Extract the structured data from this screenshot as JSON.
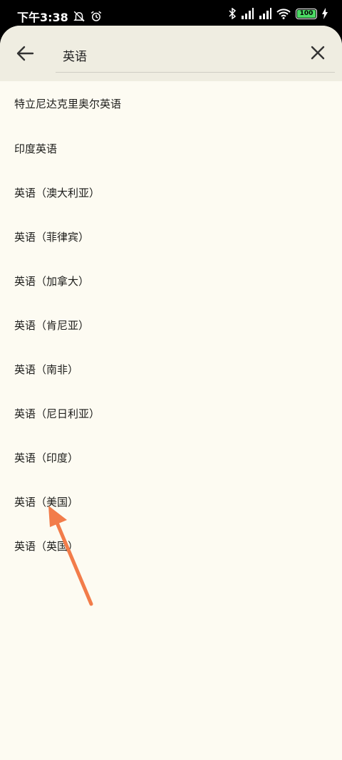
{
  "status_bar": {
    "time": "下午3:38",
    "battery": "100"
  },
  "search": {
    "value": "英语"
  },
  "results": [
    "特立尼达克里奥尔英语",
    "印度英语",
    "英语（澳大利亚）",
    "英语（菲律宾）",
    "英语（加拿大）",
    "英语（肯尼亚）",
    "英语（南非）",
    "英语（尼日利亚）",
    "英语（印度）",
    "英语（美国）",
    "英语（英国）"
  ],
  "icons": [
    "bell-off-icon",
    "alarm-icon",
    "bluetooth-icon",
    "signal-icon",
    "wifi-icon",
    "battery-icon",
    "charging-icon",
    "back-arrow-icon",
    "close-icon"
  ],
  "colors": {
    "sheet_bg": "#fdfbf2",
    "header_bg": "#efede1",
    "annotation_arrow": "#f27c4a"
  }
}
